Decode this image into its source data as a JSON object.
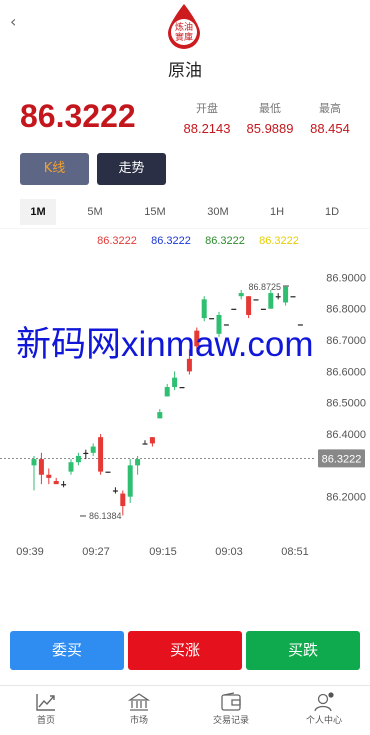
{
  "header": {
    "back_icon": "chevron-left-icon",
    "logo_text": "炼油實庫",
    "title": "原油"
  },
  "quote": {
    "price": "86.3222",
    "open_label": "开盘",
    "open": "88.2143",
    "low_label": "最低",
    "low": "85.9889",
    "high_label": "最高",
    "high": "88.454"
  },
  "modes": {
    "kline": "K线",
    "trend": "走势"
  },
  "timeframes": [
    "1M",
    "5M",
    "15M",
    "30M",
    "1H",
    "1D"
  ],
  "active_timeframe": "1M",
  "colors": {
    "up": "#e53935",
    "down": "#2fbf71",
    "accent": "#c4171d"
  },
  "chart_data": {
    "type": "candlestick",
    "ma_labels": [
      {
        "value": "86.3222",
        "color": "#e53935"
      },
      {
        "value": "86.3222",
        "color": "#1a35d8"
      },
      {
        "value": "86.3222",
        "color": "#2e8b2e"
      },
      {
        "value": "86.3222",
        "color": "#e6d000"
      }
    ],
    "y_ticks": [
      "86.9000",
      "86.8000",
      "86.7000",
      "86.6000",
      "86.5000",
      "86.4000",
      "86.2000"
    ],
    "x_ticks": [
      "09:39",
      "09:27",
      "09:15",
      "09:03",
      "08:51"
    ],
    "ylim": [
      86.1,
      86.93
    ],
    "current_price": "86.3222",
    "high_annotation": "86.8725",
    "low_annotation": "86.1384",
    "candles": [
      {
        "o": 86.3,
        "c": 86.32,
        "h": 86.33,
        "l": 86.22
      },
      {
        "o": 86.32,
        "c": 86.27,
        "h": 86.34,
        "l": 86.24
      },
      {
        "o": 86.27,
        "c": 86.26,
        "h": 86.29,
        "l": 86.24
      },
      {
        "o": 86.25,
        "c": 86.24,
        "h": 86.26,
        "l": 86.24
      },
      {
        "o": 86.24,
        "c": 86.24,
        "h": 86.25,
        "l": 86.23
      },
      {
        "o": 86.28,
        "c": 86.31,
        "h": 86.32,
        "l": 86.27
      },
      {
        "o": 86.31,
        "c": 86.33,
        "h": 86.34,
        "l": 86.3
      },
      {
        "o": 86.34,
        "c": 86.34,
        "h": 86.35,
        "l": 86.32
      },
      {
        "o": 86.34,
        "c": 86.36,
        "h": 86.37,
        "l": 86.33
      },
      {
        "o": 86.39,
        "c": 86.28,
        "h": 86.4,
        "l": 86.27
      },
      {
        "o": 86.28,
        "c": 86.28,
        "h": 86.28,
        "l": 86.28
      },
      {
        "o": 86.22,
        "c": 86.22,
        "h": 86.23,
        "l": 86.21
      },
      {
        "o": 86.21,
        "c": 86.17,
        "h": 86.22,
        "l": 86.14
      },
      {
        "o": 86.2,
        "c": 86.3,
        "h": 86.32,
        "l": 86.18
      },
      {
        "o": 86.3,
        "c": 86.32,
        "h": 86.33,
        "l": 86.27
      },
      {
        "o": 86.37,
        "c": 86.37,
        "h": 86.38,
        "l": 86.37
      },
      {
        "o": 86.39,
        "c": 86.37,
        "h": 86.39,
        "l": 86.36
      },
      {
        "o": 86.45,
        "c": 86.47,
        "h": 86.48,
        "l": 86.45
      },
      {
        "o": 86.52,
        "c": 86.55,
        "h": 86.56,
        "l": 86.52
      },
      {
        "o": 86.55,
        "c": 86.58,
        "h": 86.6,
        "l": 86.54
      },
      {
        "o": 86.55,
        "c": 86.55,
        "h": 86.55,
        "l": 86.55
      },
      {
        "o": 86.64,
        "c": 86.6,
        "h": 86.67,
        "l": 86.59
      },
      {
        "o": 86.73,
        "c": 86.68,
        "h": 86.74,
        "l": 86.67
      },
      {
        "o": 86.77,
        "c": 86.83,
        "h": 86.84,
        "l": 86.76
      },
      {
        "o": 86.77,
        "c": 86.77,
        "h": 86.77,
        "l": 86.77
      },
      {
        "o": 86.72,
        "c": 86.78,
        "h": 86.79,
        "l": 86.71
      },
      {
        "o": 86.75,
        "c": 86.75,
        "h": 86.75,
        "l": 86.75
      },
      {
        "o": 86.8,
        "c": 86.8,
        "h": 86.8,
        "l": 86.8
      },
      {
        "o": 86.84,
        "c": 86.85,
        "h": 86.86,
        "l": 86.83
      },
      {
        "o": 86.84,
        "c": 86.78,
        "h": 86.84,
        "l": 86.77
      },
      {
        "o": 86.83,
        "c": 86.83,
        "h": 86.83,
        "l": 86.83
      },
      {
        "o": 86.8,
        "c": 86.8,
        "h": 86.8,
        "l": 86.8
      },
      {
        "o": 86.8,
        "c": 86.85,
        "h": 86.86,
        "l": 86.8
      },
      {
        "o": 86.84,
        "c": 86.84,
        "h": 86.85,
        "l": 86.83
      },
      {
        "o": 86.82,
        "c": 86.87,
        "h": 86.87,
        "l": 86.81
      },
      {
        "o": 86.84,
        "c": 86.84,
        "h": 86.84,
        "l": 86.84
      },
      {
        "o": 86.75,
        "c": 86.75,
        "h": 86.75,
        "l": 86.75
      }
    ]
  },
  "actions": {
    "buy": "委买",
    "buy_up": "买涨",
    "buy_down": "买跌"
  },
  "tabbar": [
    {
      "label": "首页",
      "icon": "chart-home-icon"
    },
    {
      "label": "市场",
      "icon": "market-building-icon"
    },
    {
      "label": "交易记录",
      "icon": "wallet-icon"
    },
    {
      "label": "个人中心",
      "icon": "user-icon"
    }
  ],
  "watermark": "新码网xinmaw.com"
}
